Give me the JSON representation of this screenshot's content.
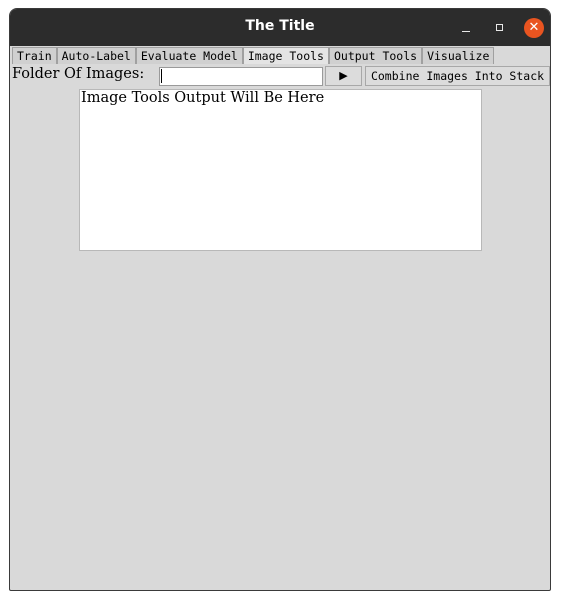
{
  "window": {
    "title": "The Title",
    "minimize_glyph": "–",
    "close_glyph": "✕"
  },
  "tabs": [
    {
      "label": "Train",
      "active": false
    },
    {
      "label": "Auto-Label",
      "active": false
    },
    {
      "label": "Evaluate Model",
      "active": false
    },
    {
      "label": "Image Tools",
      "active": true
    },
    {
      "label": "Output Tools",
      "active": false
    },
    {
      "label": "Visualize",
      "active": false
    }
  ],
  "image_tools": {
    "folder_label": "Folder Of Images:",
    "folder_value": "",
    "play_glyph": "▶",
    "combine_label": "Combine Images Into Stack",
    "output_text": "Image Tools Output Will Be Here"
  },
  "colors": {
    "titlebar": "#2c2c2c",
    "close_button": "#e95420",
    "window_bg": "#d9d9d9"
  },
  "icons": {
    "minimize": "minimize-icon",
    "maximize": "maximize-icon",
    "close": "close-icon",
    "play": "play-icon"
  }
}
